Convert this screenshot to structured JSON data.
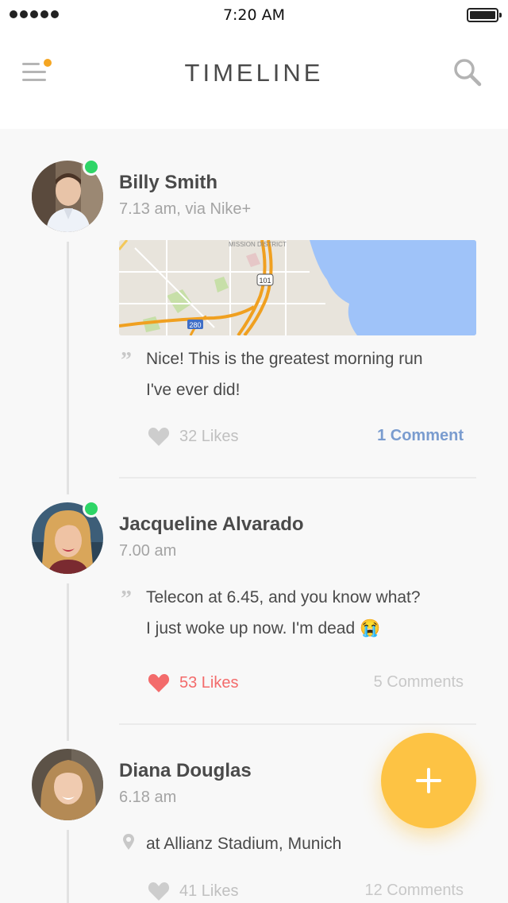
{
  "status_bar": {
    "time": "7:20 AM"
  },
  "nav": {
    "title": "TIMELINE"
  },
  "posts": [
    {
      "name": "Billy Smith",
      "meta": "7.13 am, via Nike+",
      "online": true,
      "map": {
        "district_label": "MISSION DISTRICT",
        "highway_101": "101",
        "highway_280": "280"
      },
      "text_line1": "Nice! This is the greatest morning run",
      "text_line2": "I've ever did!",
      "likes": "32 Likes",
      "liked": false,
      "comments": "1 Comment"
    },
    {
      "name": "Jacqueline Alvarado",
      "meta": "7.00 am",
      "online": true,
      "text_line1": "Telecon at 6.45, and you know what?",
      "text_line2": "I just woke up now. I'm dead 😭",
      "likes": "53 Likes",
      "liked": true,
      "comments": "5 Comments"
    },
    {
      "name": "Diana Douglas",
      "meta": "6.18 am",
      "online": false,
      "location": "at Allianz Stadium, Munich",
      "likes": "41 Likes",
      "liked": false,
      "comments": "12 Comments"
    }
  ],
  "colors": {
    "accent": "#fdc344",
    "online": "#2ed567",
    "like_active": "#f36b6b",
    "comment_link": "#7a9ccf",
    "menu_badge": "#f5a623"
  },
  "icons": [
    "menu-icon",
    "search-icon",
    "quote-icon",
    "heart-icon",
    "location-pin-icon",
    "plus-icon"
  ]
}
